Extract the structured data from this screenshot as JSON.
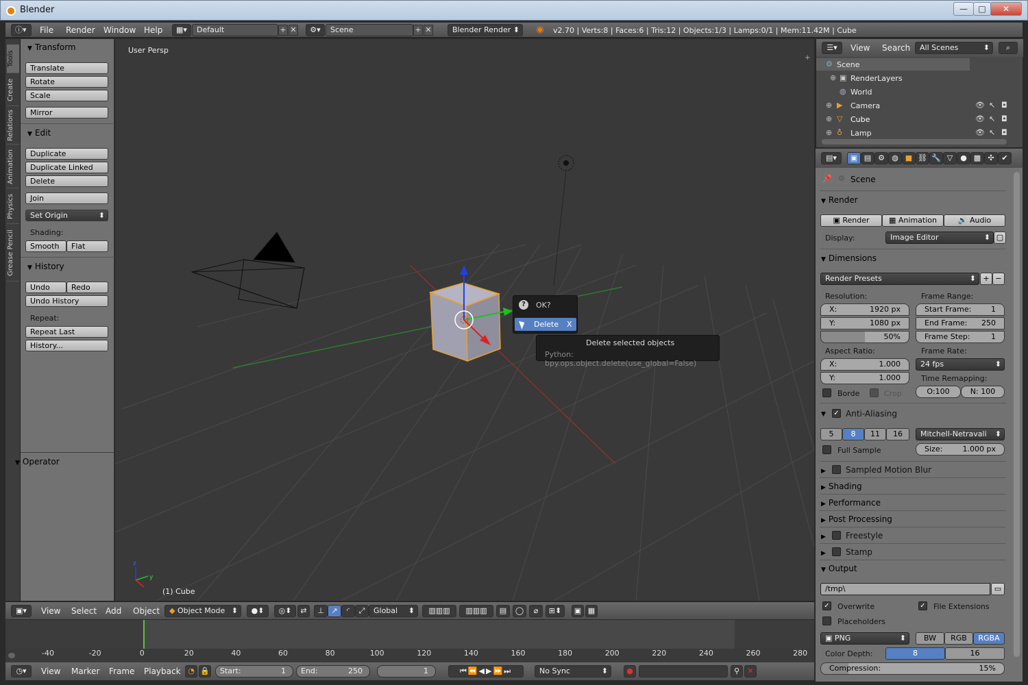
{
  "window": {
    "title": "Blender",
    "minimize": "—",
    "maximize": "□",
    "close": "✕"
  },
  "topbar": {
    "menus": [
      "File",
      "Render",
      "Window",
      "Help"
    ],
    "layout": "Default",
    "scene": "Scene",
    "engine": "Blender Render",
    "stats": "v2.70 | Verts:8 | Faces:6 | Tris:12 | Objects:1/3 | Lamps:0/1 | Mem:11.42M | Cube"
  },
  "tool_tabs": [
    "Tools",
    "Create",
    "Relations",
    "Animation",
    "Physics",
    "Grease Pencil"
  ],
  "tools": {
    "transform_title": "Transform",
    "translate": "Translate",
    "rotate": "Rotate",
    "scale": "Scale",
    "mirror": "Mirror",
    "edit_title": "Edit",
    "duplicate": "Duplicate",
    "duplicate_linked": "Duplicate Linked",
    "delete": "Delete",
    "join": "Join",
    "set_origin": "Set Origin",
    "shading_label": "Shading:",
    "smooth": "Smooth",
    "flat": "Flat",
    "history_title": "History",
    "undo": "Undo",
    "redo": "Redo",
    "undo_history": "Undo History",
    "repeat_label": "Repeat:",
    "repeat_last": "Repeat Last",
    "history_btn": "History...",
    "operator_title": "Operator"
  },
  "viewport": {
    "view_label": "User Persp",
    "object_label": "(1) Cube"
  },
  "popup": {
    "ok": "OK?",
    "delete": "Delete",
    "delete_key": "X",
    "tooltip_title": "Delete selected objects",
    "tooltip_python": "Python: bpy.ops.object.delete(use_global=False)"
  },
  "viewbar": {
    "menus": [
      "View",
      "Select",
      "Add",
      "Object"
    ],
    "mode": "Object Mode",
    "orientation": "Global"
  },
  "timeline": {
    "ticks": [
      "-40",
      "-20",
      "0",
      "20",
      "40",
      "60",
      "80",
      "100",
      "120",
      "140",
      "160",
      "180",
      "200",
      "220",
      "240",
      "260",
      "280"
    ],
    "current_frame_marker": 0
  },
  "timebar": {
    "menus": [
      "View",
      "Marker",
      "Frame",
      "Playback"
    ],
    "start_label": "Start:",
    "start": "1",
    "end_label": "End:",
    "end": "250",
    "current": "1",
    "sync": "No Sync"
  },
  "outliner": {
    "menus": [
      "View",
      "Search"
    ],
    "filter": "All Scenes",
    "items": [
      {
        "label": "Scene"
      },
      {
        "label": "RenderLayers"
      },
      {
        "label": "World"
      },
      {
        "label": "Camera"
      },
      {
        "label": "Cube"
      },
      {
        "label": "Lamp"
      }
    ]
  },
  "properties": {
    "context": "Scene",
    "render_title": "Render",
    "render_btn": "Render",
    "animation_btn": "Animation",
    "audio_btn": "Audio",
    "display_label": "Display:",
    "display_value": "Image Editor",
    "dimensions_title": "Dimensions",
    "presets": "Render Presets",
    "resolution_label": "Resolution:",
    "res_x_label": "X:",
    "res_x": "1920 px",
    "res_y_label": "Y:",
    "res_y": "1080 px",
    "res_pct": "50%",
    "frame_range_label": "Frame Range:",
    "start_frame_label": "Start Frame:",
    "start_frame": "1",
    "end_frame_label": "End Frame:",
    "end_frame": "250",
    "frame_step_label": "Frame Step:",
    "frame_step": "1",
    "aspect_label": "Aspect Ratio:",
    "asp_x_label": "X:",
    "asp_x": "1.000",
    "asp_y_label": "Y:",
    "asp_y": "1.000",
    "frame_rate_label": "Frame Rate:",
    "fps": "24 fps",
    "border": "Borde",
    "crop": "Crop",
    "remap_label": "Time Remapping:",
    "remap_old": "O:100",
    "remap_new": "N: 100",
    "aa_title": "Anti-Aliasing",
    "aa_samples": [
      "5",
      "8",
      "11",
      "16"
    ],
    "aa_filter": "Mitchell-Netravali",
    "full_sample": "Full Sample",
    "aa_size_label": "Size:",
    "aa_size": "1.000 px",
    "motion_blur": "Sampled Motion Blur",
    "shading": "Shading",
    "performance": "Performance",
    "post_processing": "Post Processing",
    "freestyle": "Freestyle",
    "stamp": "Stamp",
    "output_title": "Output",
    "output_path": "/tmp\\",
    "overwrite": "Overwrite",
    "file_ext": "File Extensions",
    "placeholders": "Placeholders",
    "format": "PNG",
    "bw": "BW",
    "rgb": "RGB",
    "rgba": "RGBA",
    "color_depth_label": "Color Depth:",
    "depth8": "8",
    "depth16": "16",
    "compression_label": "Compression:",
    "compression": "15%"
  },
  "colors": {
    "accent": "#5680c2",
    "selection": "#e8a030",
    "tooltip_bg": "#1f1f1f"
  }
}
